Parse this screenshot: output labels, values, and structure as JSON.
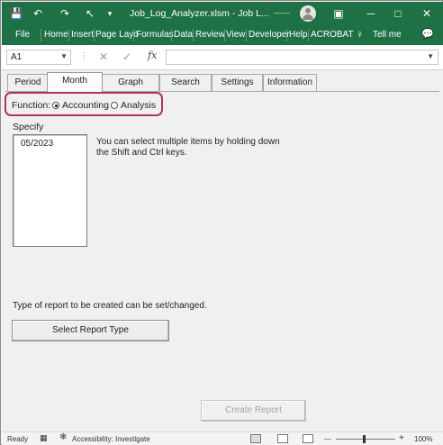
{
  "window": {
    "title": "Job_Log_Analyzer.xlsm  -  Job L...",
    "user": "––––",
    "controls": {
      "minimize": "─",
      "restore": "□",
      "close": "✕",
      "ribbon_display": "▣"
    },
    "quick_access": {
      "save": "💾",
      "undo": "↶",
      "redo": "↷",
      "pointer": "↖",
      "more": "▾"
    }
  },
  "ribbon": {
    "tabs": [
      "File",
      "Home",
      "Insert",
      "Page Layo",
      "Formulas",
      "Data",
      "Review",
      "View",
      "Developer",
      "Help",
      "ACROBAT"
    ],
    "tell_me": "Tell me",
    "tell_me_icon": "♀",
    "comments_icon": "💬"
  },
  "formula_bar": {
    "name_box": "A1",
    "cancel": "✕",
    "enter": "✓",
    "fx": "fx",
    "value": ""
  },
  "form": {
    "tabs": [
      "Period",
      "Month",
      "Graph",
      "Search",
      "Settings",
      "Information"
    ],
    "active_tab": "Month",
    "function_label": "Function:",
    "function_options": [
      {
        "label": "Accounting",
        "selected": true
      },
      {
        "label": "Analysis",
        "selected": false
      }
    ],
    "specify_label": "Specify",
    "month_list": [
      "05/2023"
    ],
    "hint": "You can select multiple items by holding down the Shift and Ctrl keys.",
    "report_type_text": "Type of report to be created can be set/changed.",
    "select_report_type_button": "Select Report Type",
    "create_report_button": "Create Report"
  },
  "status_bar": {
    "ready": "Ready",
    "accessibility": "Accessibility: Investigate",
    "zoom_minus": "—",
    "zoom_plus": "+",
    "zoom": "100%"
  },
  "colors": {
    "accent": "#1e7145",
    "highlight_outline": "#a8346b"
  }
}
